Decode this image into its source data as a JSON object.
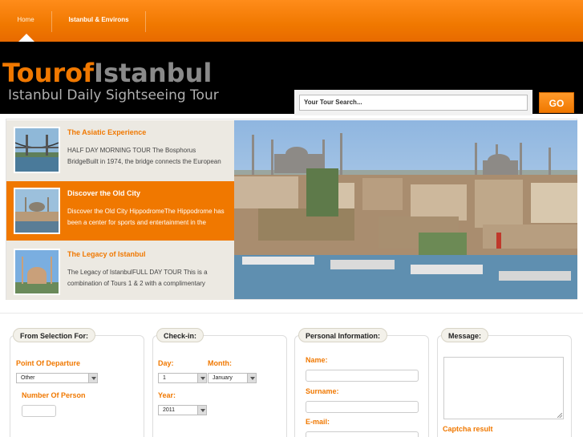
{
  "nav": {
    "items": [
      "Home",
      "Istanbul & Environs"
    ]
  },
  "header": {
    "logo_part1": "Tour",
    "logo_part2": "of",
    "logo_part3": "Istanbul",
    "tagline": "Istanbul Daily Sightseeing Tour",
    "search_value": "Your Tour Search...",
    "go_label": "GO"
  },
  "tours": [
    {
      "title": "The Asiatic Experience",
      "desc": "HALF DAY MORNING TOUR The Bosphorus BridgeBuilt in 1974, the bridge connects the European"
    },
    {
      "title": "Discover the Old City",
      "desc": "Discover the Old City HippodromeThe Hippodrome has been a center for sports and entertainment in the"
    },
    {
      "title": "The Legacy of Istanbul",
      "desc": "The Legacy of IstanbulFULL DAY TOUR This is a combination of Tours 1 & 2 with a complimentary"
    }
  ],
  "form": {
    "selection": {
      "legend": "From Selection For:",
      "departure_label": "Point Of Departure",
      "departure_value": "Other",
      "persons_label": "Number Of Person"
    },
    "checkin": {
      "legend": "Check-in:",
      "day_label": "Day:",
      "day_value": "1",
      "month_label": "Month:",
      "month_value": "January",
      "year_label": "Year:",
      "year_value": "2011"
    },
    "personal": {
      "legend": "Personal Information:",
      "name_label": "Name:",
      "surname_label": "Surname:",
      "email_label": "E-mail:"
    },
    "message": {
      "legend": "Message:",
      "captcha_label": "Captcha result"
    }
  },
  "colors": {
    "accent": "#f07800",
    "header_bg": "#000000",
    "panel_bg": "#ece9e2"
  }
}
